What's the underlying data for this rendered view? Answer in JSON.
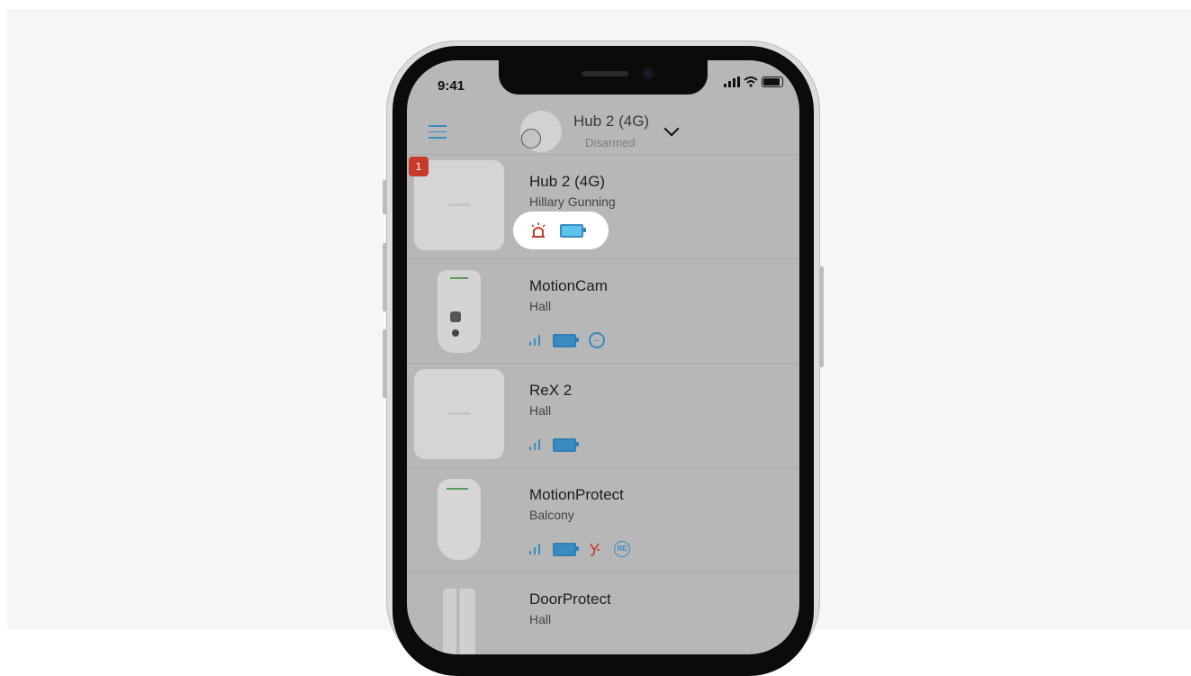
{
  "status_bar": {
    "time": "9:41"
  },
  "header": {
    "hub_title": "Hub 2 (4G)",
    "hub_status": "Disarmed"
  },
  "devices": [
    {
      "name": "Hub 2 (4G)",
      "room": "Hillary Gunning",
      "alert_count": "1",
      "icons": [
        "siren-alarm-icon",
        "battery-icon"
      ]
    },
    {
      "name": "MotionCam",
      "room": "Hall",
      "icons": [
        "signal-icon",
        "battery-icon",
        "delay-icon"
      ]
    },
    {
      "name": "ReX 2",
      "room": "Hall",
      "icons": [
        "signal-icon",
        "battery-icon"
      ]
    },
    {
      "name": "MotionProtect",
      "room": "Balcony",
      "icons": [
        "signal-icon",
        "battery-icon",
        "tamper-icon",
        "rex-icon"
      ],
      "rex_label": "RE"
    },
    {
      "name": "DoorProtect",
      "room": "Hall"
    }
  ],
  "colors": {
    "accent": "#3a8bc2",
    "alert": "#c53a2b",
    "overlay": "#b7b7b7"
  }
}
